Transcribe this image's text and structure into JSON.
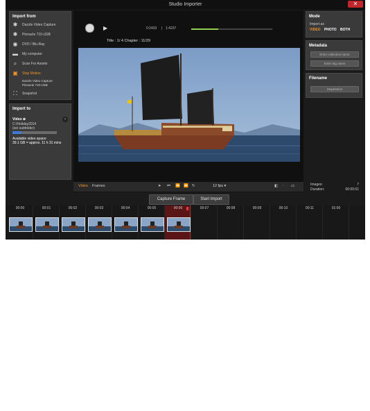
{
  "window": {
    "title": "Studio Importer",
    "close_label": "✕"
  },
  "import_from": {
    "title": "Import from",
    "items": [
      {
        "label": "Dazzle Video Capture",
        "icon": "gear-icon"
      },
      {
        "label": "Pinnacle 710-USB",
        "icon": "gear-icon"
      },
      {
        "label": "DVD / Blu-Ray",
        "icon": "disc-icon"
      },
      {
        "label": "My computer",
        "icon": "folder-icon"
      },
      {
        "label": "Scan For Assets",
        "icon": "magnifier-icon"
      },
      {
        "label": "Stop Motion",
        "icon": "stop-motion-icon",
        "selected": true
      },
      {
        "label": "Snapshot",
        "icon": "snapshot-icon"
      }
    ],
    "stop_motion_device": "Dazzle Video Capture",
    "stop_motion_sub": "Pinnacle 710-USB"
  },
  "import_to": {
    "title": "Import to",
    "video_label": "Video ⊕",
    "path_line1": "C:\\Holiday2014",
    "path_line2": "(set subfolder)",
    "space_label": "Available video space:",
    "space_value": "39.1 GB = approx. 11 h 31 mins",
    "space_fill": 0.2
  },
  "viewer": {
    "timecode": "0:2433",
    "timecode_total": "1:4237",
    "title_chapter": "Title : 1/ 4   Chapter : 11/29",
    "progress": 0.33
  },
  "controls": {
    "video_tab": "Video",
    "frames_tab": "Frames",
    "fps": "12 fps ▾",
    "images_label": "Images:",
    "images_value": "7",
    "duration_label": "Duration:",
    "duration_value": "00:00:01"
  },
  "buttons": {
    "capture": "Capture Frame",
    "start": "Start Import"
  },
  "mode": {
    "title": "Mode",
    "import_as": "Import as",
    "options": [
      "VIDEO",
      "PHOTO",
      "BOTH"
    ],
    "selected": "VIDEO"
  },
  "metadata": {
    "title": "Metadata",
    "collection_placeholder": "Enter collection name",
    "tag_placeholder": "Enter tag name"
  },
  "filename": {
    "title": "Filename",
    "value": "StopMotion"
  },
  "timeline": {
    "ticks": [
      "00:00",
      "00:01",
      "00:02",
      "00:03",
      "00:04",
      "00:05",
      "00:06",
      "00:07",
      "00:08",
      "00:09",
      "00:10",
      "00:11",
      "01:00"
    ],
    "frame_count": 7
  },
  "colors": {
    "accent": "#f0932b",
    "playhead": "#a82a2a"
  }
}
